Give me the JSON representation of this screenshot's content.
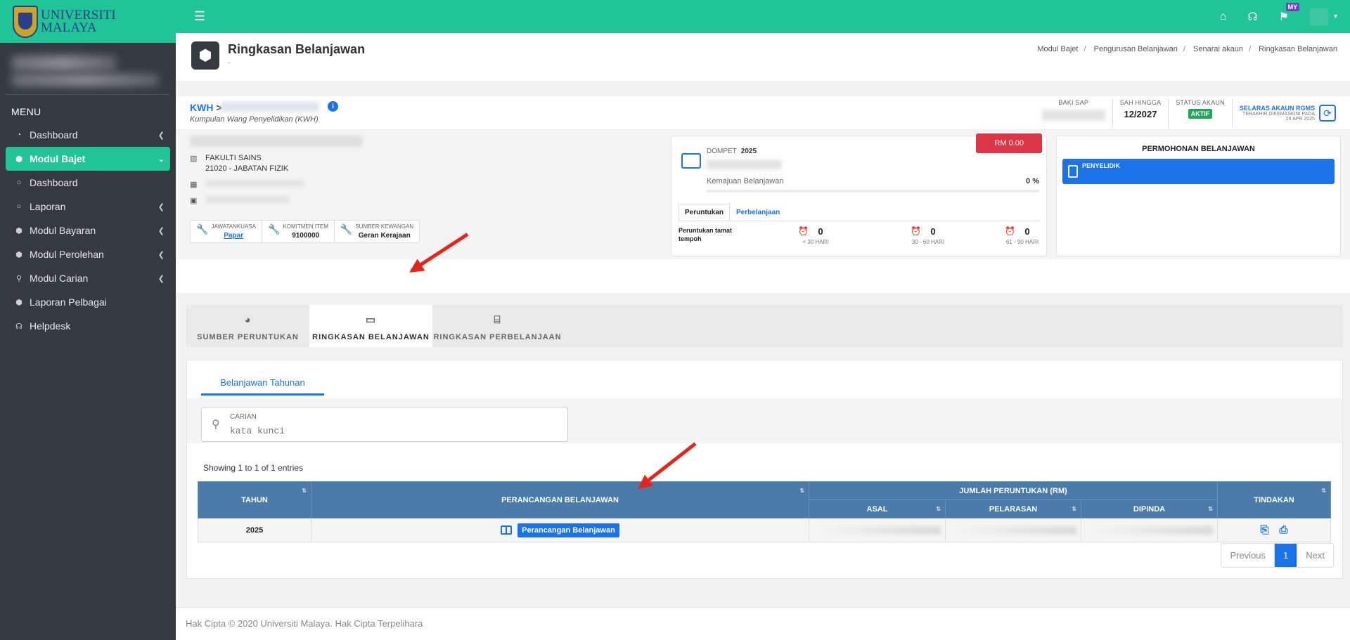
{
  "brand": {
    "name_line1": "UNIVERSITI",
    "name_line2": "MALAYA"
  },
  "sidebar": {
    "menu_heading": "MENU",
    "items": [
      {
        "label": "Dashboard",
        "icon": "dashboard-icon"
      },
      {
        "label": "Modul Bajet",
        "icon": "cube-icon"
      },
      {
        "label": "Dashboard",
        "icon": "circle-icon"
      },
      {
        "label": "Laporan",
        "icon": "circle-icon"
      },
      {
        "label": "Modul Bayaran",
        "icon": "cube-icon"
      },
      {
        "label": "Modul Perolehan",
        "icon": "cube-icon"
      },
      {
        "label": "Modul Carian",
        "icon": "search-icon"
      },
      {
        "label": "Laporan Pelbagai",
        "icon": "cube-icon"
      },
      {
        "label": "Helpdesk",
        "icon": "headset-icon"
      }
    ]
  },
  "topbar": {
    "lang_badge": "MY"
  },
  "page": {
    "title": "Ringkasan Belanjawan",
    "subtitle": "-"
  },
  "breadcrumb": [
    "Modul Bajet",
    "Pengurusan Belanjawan",
    "Senarai akaun",
    "Ringkasan Belanjawan"
  ],
  "account": {
    "code": "KWH",
    "separator": ">",
    "fund_name": "Kumpulan Wang Penyelidikan (KWH)",
    "stats": {
      "baki_sap_label": "BAKI SAP",
      "sah_hingga_label": "SAH HINGGA",
      "sah_hingga_value": "12/2027",
      "status_label": "STATUS AKAUN",
      "status_value": "AKTIF",
      "selaras_title": "SELARAS AKAUN RGMS",
      "selaras_sub": "TERAKHIR DIKEMASKINI PADA",
      "selaras_date": "24 APR 2025"
    },
    "faculty": "FAKULTI SAINS",
    "department": "21020 - JABATAN FIZIK",
    "chips": [
      {
        "label": "JAWATANKUASA",
        "value": "Papar"
      },
      {
        "label": "KOMITMEN ITEM",
        "value": "9100000"
      },
      {
        "label": "SUMBER KEWANGAN",
        "value": "Geran Kerajaan"
      }
    ]
  },
  "wallet": {
    "label": "DOMPET",
    "year": "2025",
    "amount": "RM 0.00",
    "progress_label": "Kemajuan Belanjawan",
    "progress_pct": "0 %",
    "progress_value": 0,
    "tabs": [
      "Peruntukan",
      "Perbelanjaan"
    ],
    "expiry_label": "Peruntukan tamat tempoh",
    "buckets": [
      {
        "count": "0",
        "range": "< 30 HARI"
      },
      {
        "count": "0",
        "range": "30 - 60 HARI"
      },
      {
        "count": "0",
        "range": "61 - 90 HARI"
      }
    ]
  },
  "permohonan": {
    "title": "PERMOHONAN BELANJAWAN",
    "button": "PENYELIDIK"
  },
  "main_tabs": [
    "SUMBER PERUNTUKAN",
    "RINGKASAN BELANJAWAN",
    "RINGKASAN PERBELANJAAN"
  ],
  "panel": {
    "tab": "Belanjawan Tahunan",
    "search_label": "CARIAN",
    "search_placeholder": "kata kunci",
    "showing": "Showing 1 to 1 of 1 entries",
    "table": {
      "headers": {
        "tahun": "TAHUN",
        "perancangan": "PERANCANGAN BELANJAWAN",
        "jumlah": "JUMLAH PERUNTUKAN (RM)",
        "asal": "ASAL",
        "pelarasan": "PELARASAN",
        "dipinda": "DIPINDA",
        "tindakan": "TINDAKAN"
      },
      "rows": [
        {
          "tahun": "2025",
          "button": "Perancangan Belanjawan"
        }
      ]
    },
    "pager": {
      "previous": "Previous",
      "page": "1",
      "next": "Next"
    }
  },
  "footer": "Hak Cipta © 2020 Universiti Malaya. Hak Cipta Terpelihara"
}
